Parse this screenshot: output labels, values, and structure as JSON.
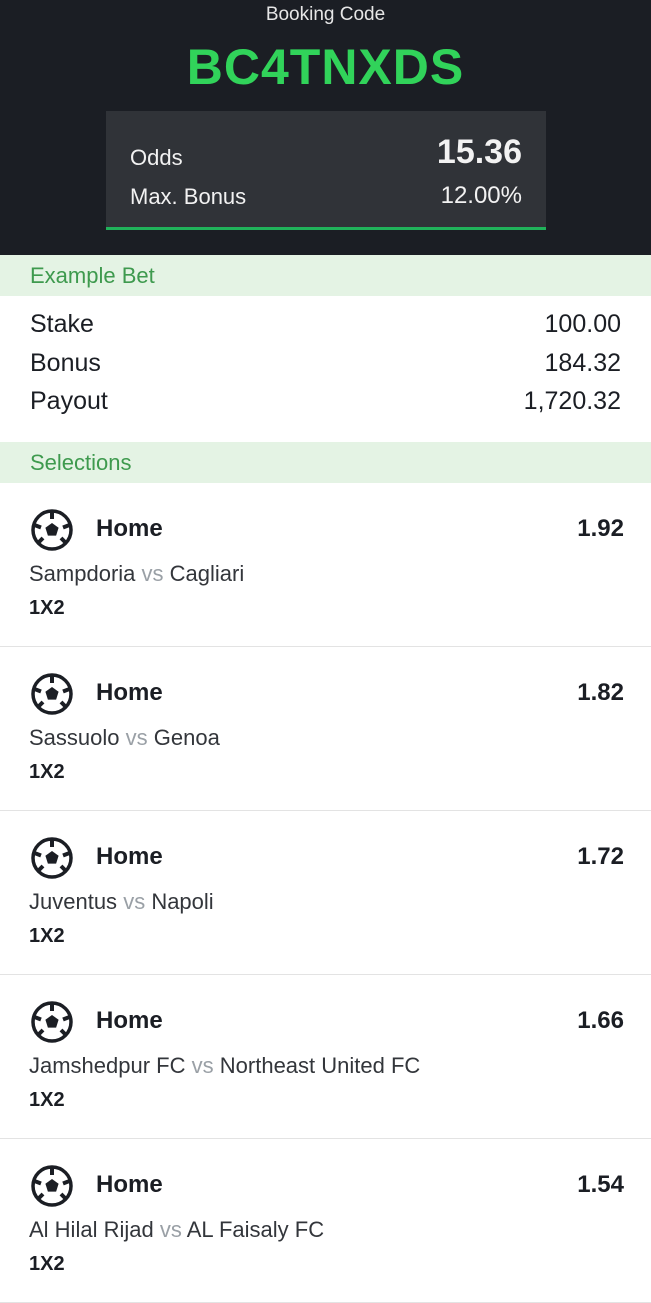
{
  "header": {
    "booking_label": "Booking Code",
    "booking_code": "BC4TNXDS",
    "odds_label": "Odds",
    "odds_value": "15.36",
    "bonus_label": "Max. Bonus",
    "bonus_value": "12.00%",
    "accent_color": "#31d35a"
  },
  "example_bet": {
    "title": "Example Bet",
    "rows": [
      {
        "label": "Stake",
        "value": "100.00"
      },
      {
        "label": "Bonus",
        "value": "184.32"
      },
      {
        "label": "Payout",
        "value": "1,720.32"
      }
    ]
  },
  "selections": {
    "title": "Selections",
    "vs_text": "vs",
    "items": [
      {
        "icon": "soccer-ball-icon",
        "pick": "Home",
        "odds": "1.92",
        "home": "Sampdoria",
        "away": "Cagliari",
        "market": "1X2"
      },
      {
        "icon": "soccer-ball-icon",
        "pick": "Home",
        "odds": "1.82",
        "home": "Sassuolo",
        "away": "Genoa",
        "market": "1X2"
      },
      {
        "icon": "soccer-ball-icon",
        "pick": "Home",
        "odds": "1.72",
        "home": "Juventus",
        "away": "Napoli",
        "market": "1X2"
      },
      {
        "icon": "soccer-ball-icon",
        "pick": "Home",
        "odds": "1.66",
        "home": "Jamshedpur FC",
        "away": "Northeast United FC",
        "market": "1X2"
      },
      {
        "icon": "soccer-ball-icon",
        "pick": "Home",
        "odds": "1.54",
        "home": "Al Hilal Rijad",
        "away": "AL Faisaly FC",
        "market": "1X2"
      }
    ]
  }
}
